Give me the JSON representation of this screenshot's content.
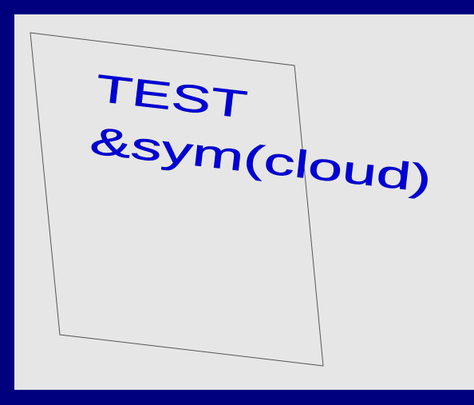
{
  "canvas": {
    "text_line_1": "TEST",
    "text_line_2": "&sym(cloud)",
    "text_color": "#0000d8",
    "background_color": "#e6e6e6",
    "frame_color": "#00007f",
    "box_stroke_color": "#555555"
  }
}
